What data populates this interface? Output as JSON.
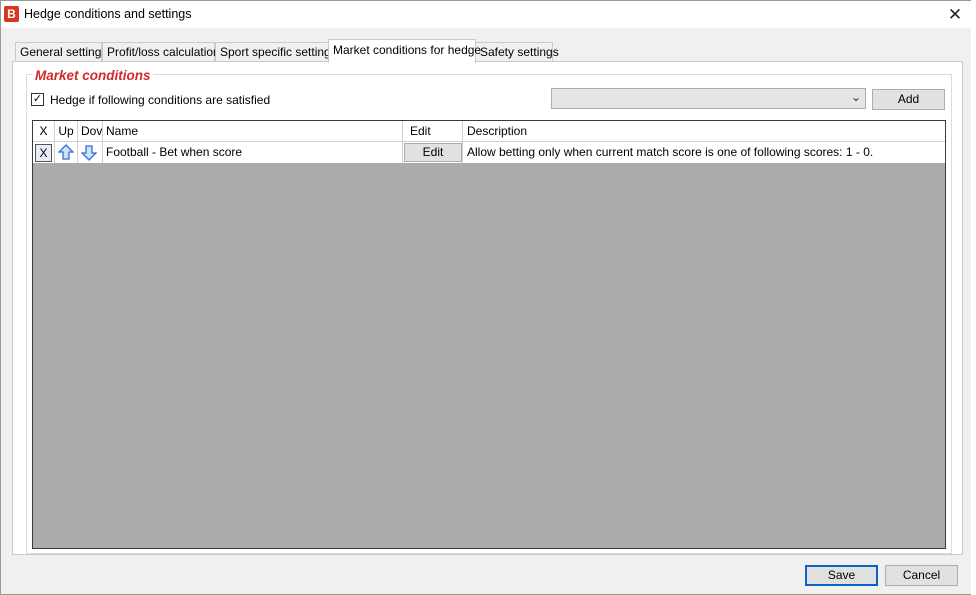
{
  "window": {
    "title": "Hedge conditions and settings",
    "app_icon_letter": "B",
    "close_symbol": "✕"
  },
  "tabs": [
    {
      "label": "General settings",
      "active": false
    },
    {
      "label": "Profit/loss calculation",
      "active": false
    },
    {
      "label": "Sport specific settings",
      "active": false
    },
    {
      "label": "Market conditions for hedge",
      "active": true
    },
    {
      "label": "Safety settings",
      "active": false
    }
  ],
  "market_conditions": {
    "group_title": "Market conditions",
    "hedge_checkbox": {
      "label": "Hedge if following conditions are satisfied",
      "checked": true,
      "mark": "✓"
    },
    "condition_select": {
      "selected": "",
      "arrow": "⌄"
    },
    "add_label": "Add"
  },
  "grid": {
    "columns": {
      "x": "X",
      "up": "Up",
      "down": "Dov",
      "name": "Name",
      "edit": "Edit",
      "description": "Description"
    },
    "rows": [
      {
        "x_label": "X",
        "name": "Football - Bet when score",
        "edit_label": "Edit",
        "description": "Allow betting only when current match score is one of following scores: 1 - 0."
      }
    ]
  },
  "footer": {
    "save_label": "Save",
    "cancel_label": "Cancel"
  },
  "colors": {
    "accent": "#d02a2a",
    "grid_empty": "#ababab",
    "icon_blue": "#2f6fd8"
  }
}
